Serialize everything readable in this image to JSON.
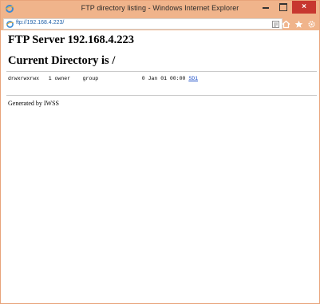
{
  "window": {
    "title": "FTP directory listing - Windows Internet Explorer",
    "close_glyph": "×"
  },
  "address_bar": {
    "url": "ftp://192.168.4.223/"
  },
  "page": {
    "server_heading": "FTP Server 192.168.4.223",
    "directory_heading": "Current Directory is /",
    "entries": [
      {
        "permissions": "drwxrwxrwx",
        "links": "1",
        "owner": "owner",
        "group": "group",
        "size": "0",
        "date": "Jan 01 00:00",
        "name": "SD1"
      }
    ],
    "footer": "Generated by IWSS"
  },
  "icons": {
    "app": "ie-logo-icon",
    "page": "ie-page-icon",
    "compat": "compatibility-view-icon",
    "home": "home-icon",
    "favorites": "star-icon",
    "tools": "gear-icon"
  },
  "colors": {
    "titlebar": "#f0b48b",
    "close": "#c7372f",
    "link": "#1d4fc8",
    "url": "#1e5fa8"
  }
}
